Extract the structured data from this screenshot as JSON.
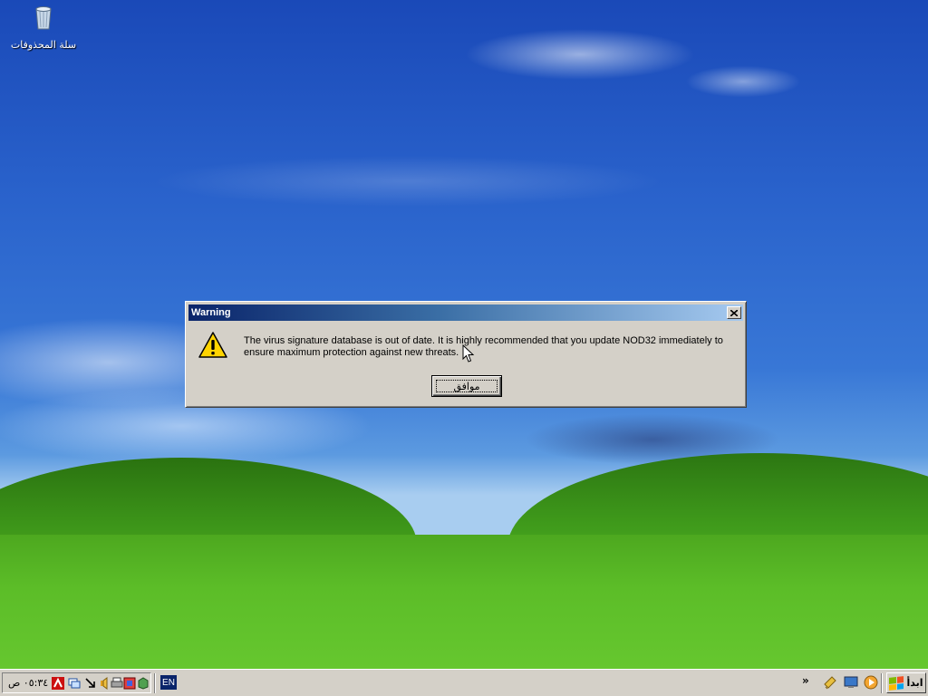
{
  "desktop": {
    "recycle_bin_label": "سلة المحذوفات"
  },
  "dialog": {
    "title": "Warning",
    "close_label": "X",
    "message": "The virus signature database is out of date. It is highly recommended that you update NOD32 immediately to ensure maximum protection against new threats.",
    "ok_label": "موافق",
    "icon": "warning-icon"
  },
  "taskbar": {
    "start_label": "ابدأ",
    "chevron": "»",
    "language": "EN",
    "clock": "٠٥:٣٤ ص",
    "quick_launch_icons": [
      "media-player-icon",
      "desktop-icon",
      "messenger-icon"
    ],
    "tray_icons": [
      "antivirus-icon",
      "network-icon",
      "volume-icon",
      "printer-icon",
      "arrow-icon",
      "folder-icon",
      "shield-icon"
    ]
  }
}
